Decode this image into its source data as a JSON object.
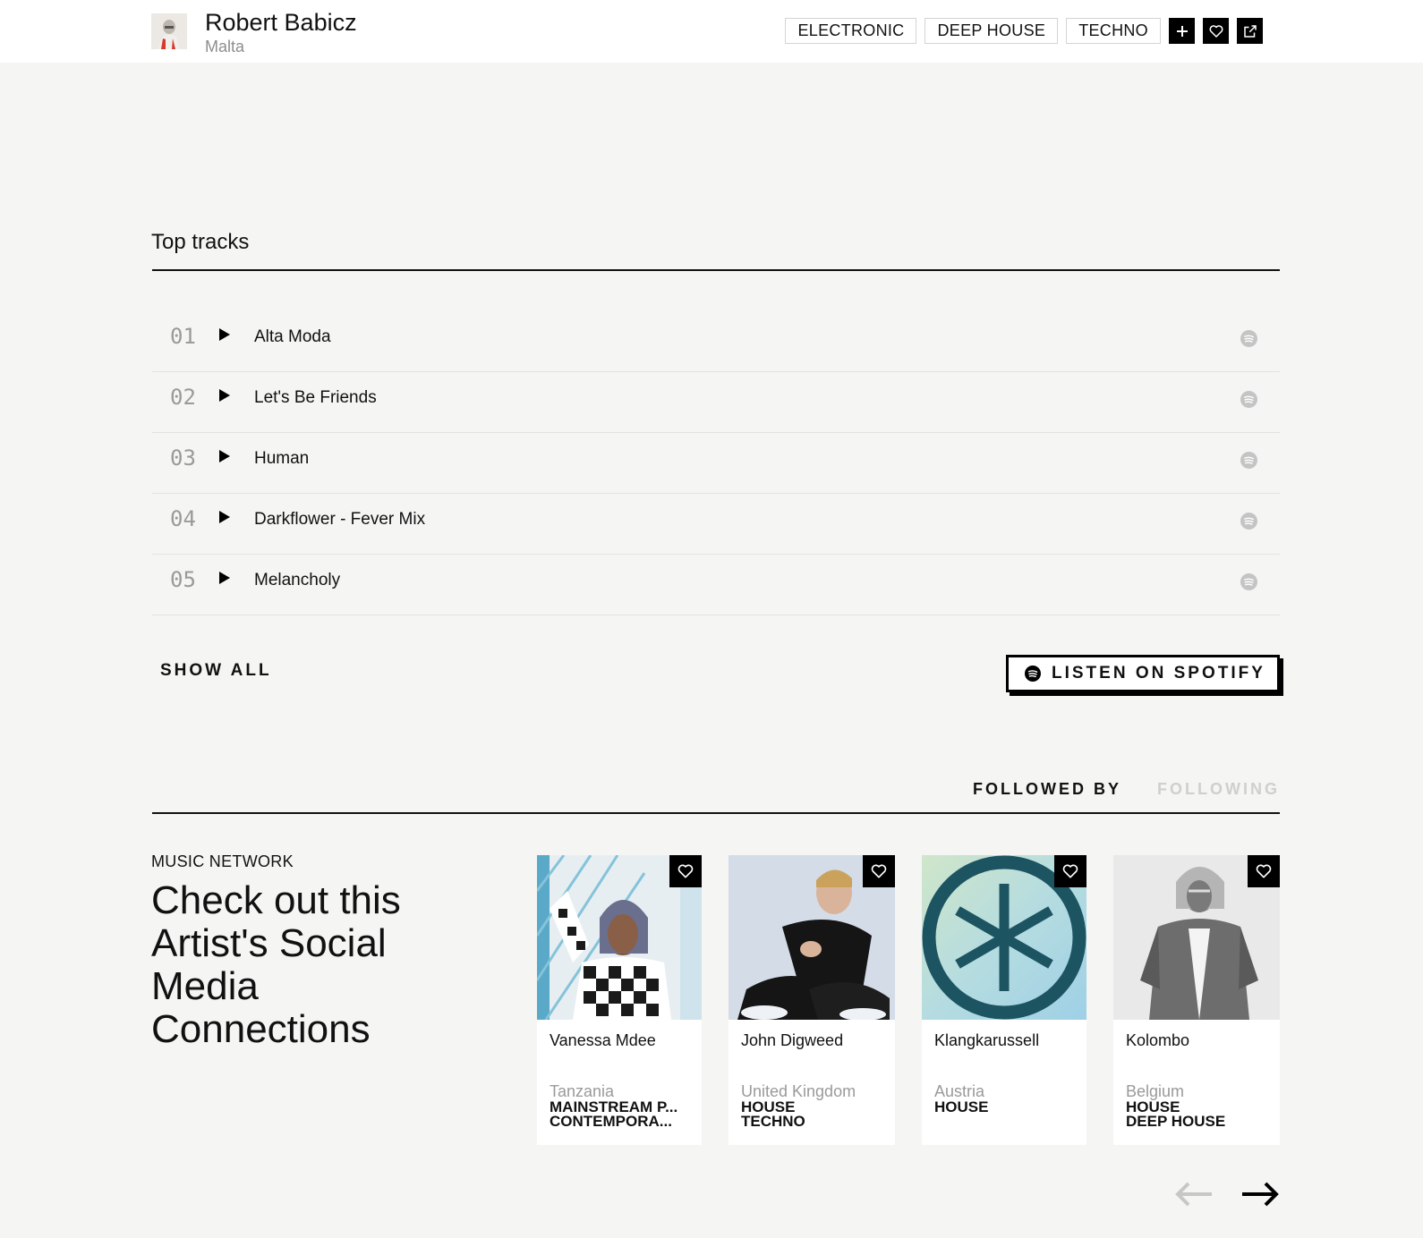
{
  "header": {
    "artist_name": "Robert Babicz",
    "country": "Malta",
    "tags": [
      "ELECTRONIC",
      "DEEP HOUSE",
      "TECHNO"
    ]
  },
  "top_tracks": {
    "title": "Top tracks",
    "tracks": [
      {
        "num": "01",
        "title": "Alta Moda"
      },
      {
        "num": "02",
        "title": "Let's Be Friends"
      },
      {
        "num": "03",
        "title": "Human"
      },
      {
        "num": "04",
        "title": "Darkflower - Fever Mix"
      },
      {
        "num": "05",
        "title": "Melancholy"
      }
    ],
    "show_all_label": "SHOW ALL",
    "listen_label": "LISTEN ON SPOTIFY"
  },
  "social": {
    "tabs": [
      "FOLLOWED BY",
      "FOLLOWING"
    ],
    "eyebrow": "MUSIC NETWORK",
    "headline": "Check out this Artist's Social Media Connections",
    "cards": [
      {
        "name": "Vanessa Mdee",
        "country": "Tanzania",
        "genres": [
          "MAINSTREAM P...",
          "CONTEMPORA..."
        ]
      },
      {
        "name": "John Digweed",
        "country": "United Kingdom",
        "genres": [
          "HOUSE",
          "TECHNO"
        ]
      },
      {
        "name": "Klangkarussell",
        "country": "Austria",
        "genres": [
          "HOUSE"
        ]
      },
      {
        "name": "Kolombo",
        "country": "Belgium",
        "genres": [
          "HOUSE",
          "DEEP HOUSE"
        ]
      }
    ]
  },
  "colors": {
    "background": "#f5f5f3",
    "accent": "#000000",
    "muted": "#9a9a9a",
    "klangkarussell_teal": "#1d5462"
  }
}
